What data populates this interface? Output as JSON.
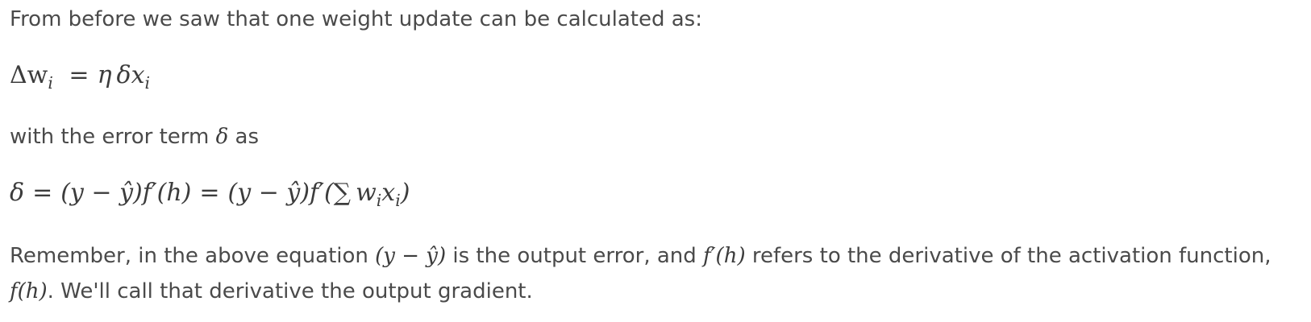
{
  "document": {
    "intro_text": "From before we saw that one weight update can be calculated as:",
    "update_equation": {
      "lhs": "Δw",
      "lhs_sub": "i",
      "eq": "=",
      "rhs_eta": "η",
      "rhs_delta": "δ",
      "rhs_x": "x",
      "rhs_x_sub": "i"
    },
    "error_text_before": "with the error term ",
    "error_symbol": "δ",
    "error_text_after": " as",
    "delta_equation": {
      "part1": "δ",
      "eq1": "=",
      "part2": "(y − ŷ)f′(h)",
      "eq2": "=",
      "part3": "(y − ŷ)f′(∑",
      "part4": "w",
      "part4_sub": "i",
      "part5": "x",
      "part5_sub": "i",
      "part6": ")"
    },
    "remember": {
      "text1": "Remember, in the above equation ",
      "math1": "(y − ŷ)",
      "text2": " is the output error, and ",
      "math2": "f′(h)",
      "text3": " refers to the derivative of the activation function,",
      "math3": "f(h)",
      "text4": ". We'll call that derivative the output gradient."
    }
  }
}
